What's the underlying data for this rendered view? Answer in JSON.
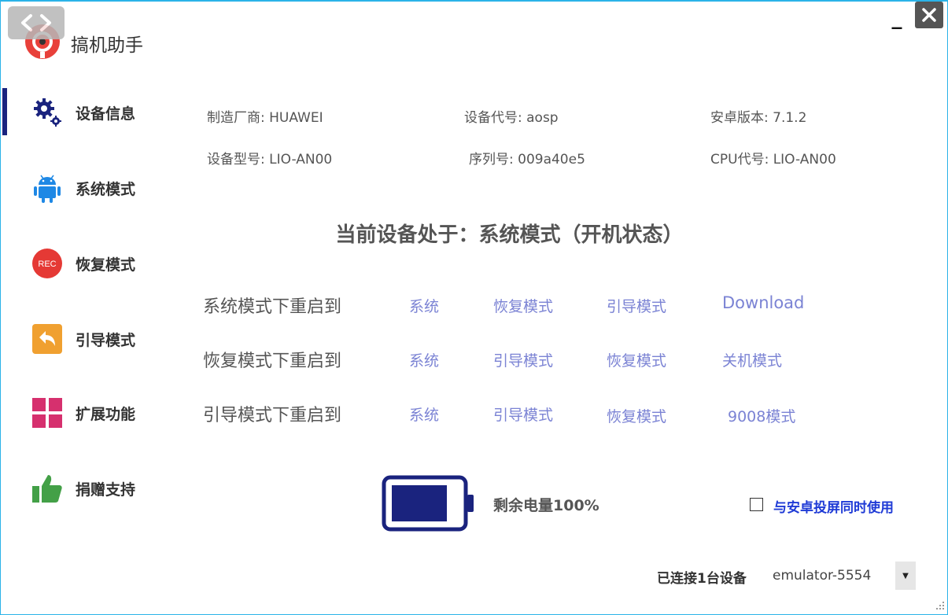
{
  "app": {
    "title": "搞机助手",
    "minimize_glyph": "_",
    "close_glyph": "✕",
    "accent_color": "#1a237e",
    "link_color": "#7b83d4"
  },
  "sidebar": {
    "items": [
      {
        "label": "设备信息",
        "icon": "gear-icon",
        "active": true
      },
      {
        "label": "系统模式",
        "icon": "android-icon"
      },
      {
        "label": "恢复模式",
        "icon": "rec-icon",
        "icon_text": "REC"
      },
      {
        "label": "引导模式",
        "icon": "back-arrow-icon"
      },
      {
        "label": "扩展功能",
        "icon": "grid-icon"
      },
      {
        "label": "捐赠支持",
        "icon": "thumbs-up-icon"
      }
    ]
  },
  "device_info": {
    "manufacturer": "制造厂商: HUAWEI",
    "device_code": "设备代号: aosp",
    "android_version": "安卓版本: 7.1.2",
    "device_model": "设备型号: LIO-AN00",
    "serial": "序列号: 009a40e5",
    "cpu_code": "CPU代号: LIO-AN00"
  },
  "status": "当前设备处于：系统模式（开机状态）",
  "reboot_rows": [
    {
      "label": "系统模式下重启到",
      "options": [
        "系统",
        "恢复模式",
        "引导模式",
        "Download"
      ]
    },
    {
      "label": "恢复模式下重启到",
      "options": [
        "系统",
        "引导模式",
        "恢复模式",
        "关机模式"
      ]
    },
    {
      "label": "引导模式下重启到",
      "options": [
        "系统",
        "引导模式",
        "恢复模式",
        "9008模式"
      ]
    }
  ],
  "battery": {
    "text": "剩余电量100%",
    "level": 1.0
  },
  "screen_mirror_checkbox": {
    "label": "与安卓投屏同时使用",
    "checked": false
  },
  "footer": {
    "connected_text": "已连接1台设备",
    "device_selected": "emulator-5554"
  }
}
